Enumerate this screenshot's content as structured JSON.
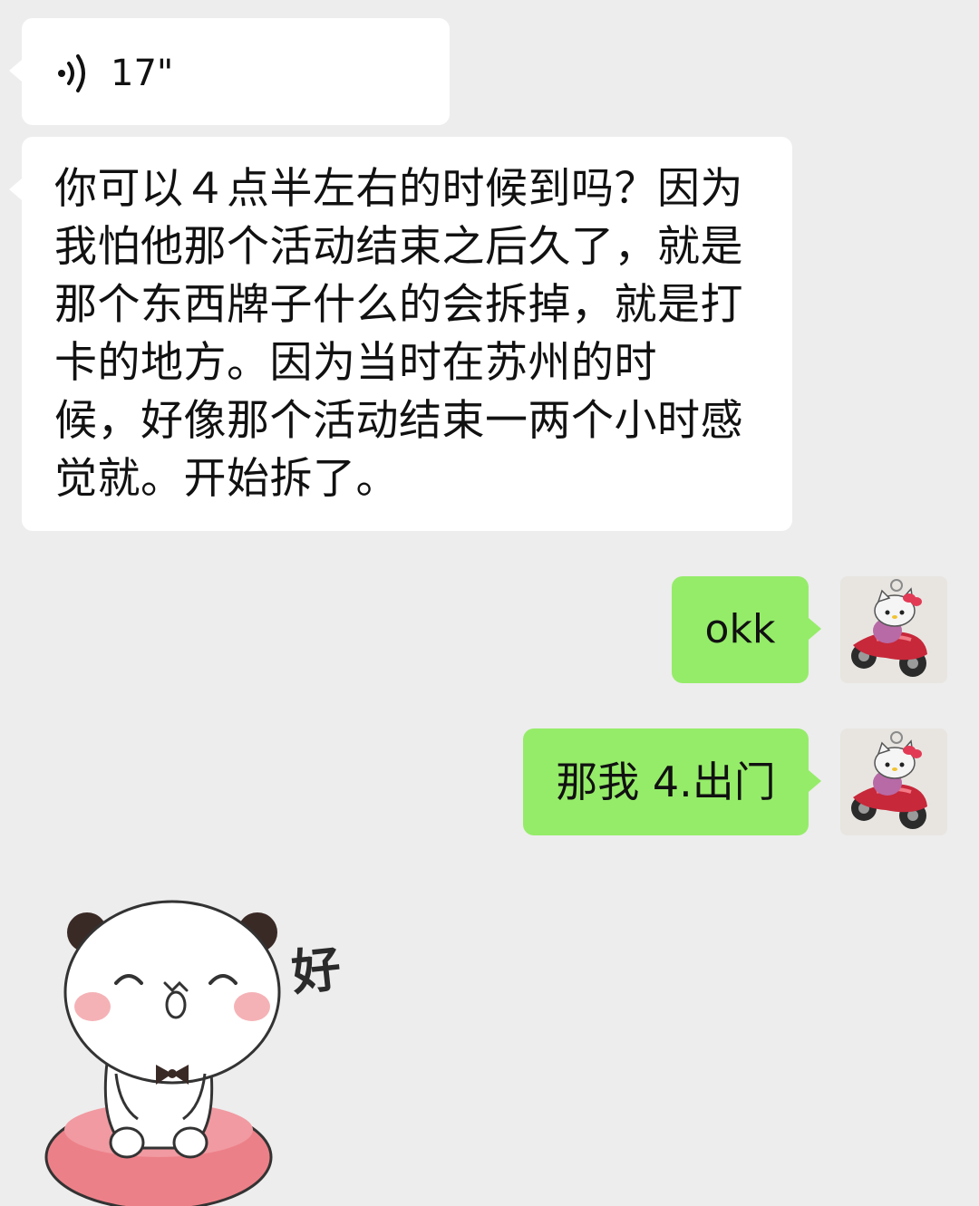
{
  "colors": {
    "background": "#ededed",
    "incoming_bubble": "#ffffff",
    "outgoing_bubble": "#95ec69",
    "text": "#111111"
  },
  "messages": [
    {
      "type": "voice",
      "side": "left",
      "icon": "voice-wave-icon",
      "duration": "17\""
    },
    {
      "type": "text",
      "side": "left",
      "text": "你可以４点半左右的时候到吗？因为\n我怕他那个活动结束之后久了，就是\n那个东西牌子什么的会拆掉，就是打\n卡的地方。因为当时在苏州的时\n候，好像那个活动结束一两个小时感\n觉就。开始拆了。"
    },
    {
      "type": "text",
      "side": "right",
      "text": "okk",
      "avatar": "hello-kitty-avatar"
    },
    {
      "type": "text",
      "side": "right",
      "text": "那我 4.出门",
      "avatar": "hello-kitty-avatar"
    },
    {
      "type": "sticker",
      "side": "left",
      "icon": "panda-sticker",
      "caption": "好"
    }
  ]
}
